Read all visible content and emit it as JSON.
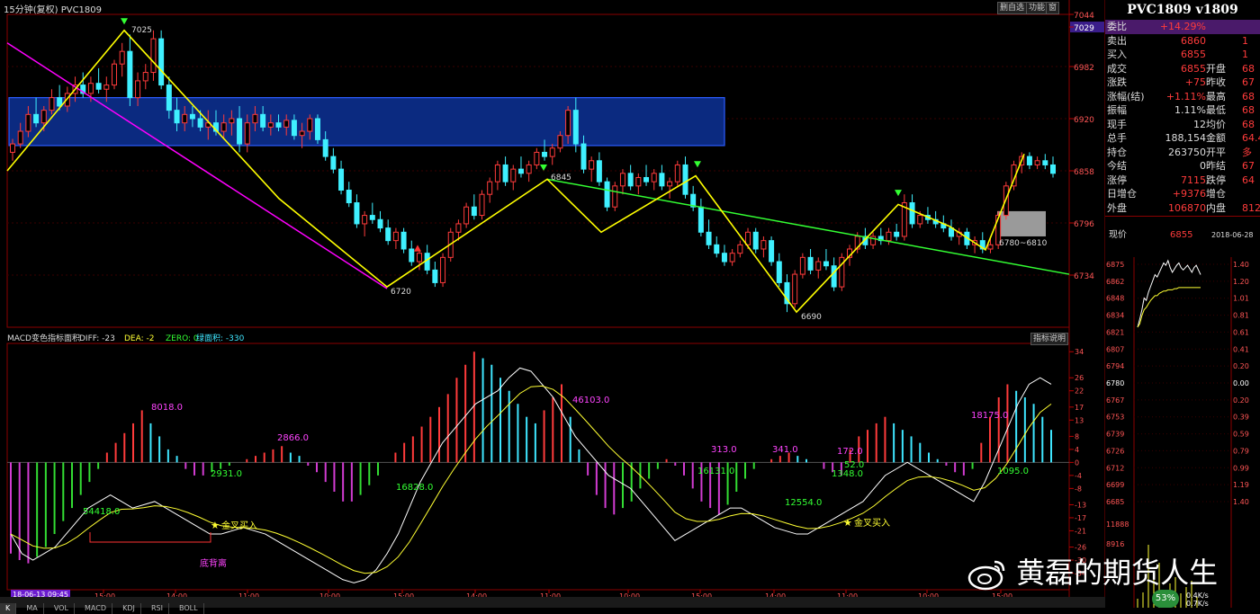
{
  "window": {
    "title": "15分钟(复权)  PVC1809",
    "buttons": [
      "删自选",
      "功能",
      "窗"
    ]
  },
  "price_axis": {
    "ticks": [
      "7044",
      "7029",
      "6982",
      "6920",
      "6858",
      "6796",
      "6734"
    ],
    "current_price_label": "7029"
  },
  "chart_data": [
    {
      "type": "candlestick",
      "title": "15分钟(复权)  PVC1809",
      "ylim": [
        6672,
        7044
      ],
      "x_labels": [
        "18-06-13 09:45",
        "15:00",
        "14:00",
        "11:00",
        "10:00",
        "15:00",
        "14:00",
        "11:00",
        "10:00",
        "15:00",
        "14:00",
        "11:00",
        "10:00",
        "15:00"
      ],
      "annotations": [
        "7025",
        "6720",
        "6845",
        "6690",
        "6780~6810"
      ],
      "ohlc": [
        [
          6880,
          6896,
          6870,
          6890
        ],
        [
          6890,
          6915,
          6885,
          6905
        ],
        [
          6905,
          6935,
          6898,
          6925
        ],
        [
          6925,
          6945,
          6910,
          6915
        ],
        [
          6915,
          6935,
          6905,
          6930
        ],
        [
          6930,
          6955,
          6925,
          6945
        ],
        [
          6945,
          6960,
          6930,
          6935
        ],
        [
          6935,
          6958,
          6928,
          6950
        ],
        [
          6950,
          6970,
          6940,
          6960
        ],
        [
          6960,
          6975,
          6945,
          6950
        ],
        [
          6950,
          6970,
          6940,
          6962
        ],
        [
          6962,
          6980,
          6950,
          6955
        ],
        [
          6955,
          6970,
          6940,
          6960
        ],
        [
          6960,
          6990,
          6955,
          6985
        ],
        [
          6985,
          7010,
          6970,
          7000
        ],
        [
          7000,
          7020,
          6935,
          6945
        ],
        [
          6945,
          6975,
          6935,
          6965
        ],
        [
          6965,
          6985,
          6955,
          6975
        ],
        [
          6975,
          7025,
          6965,
          7015
        ],
        [
          7015,
          7025,
          6955,
          6960
        ],
        [
          6960,
          6970,
          6920,
          6930
        ],
        [
          6930,
          6945,
          6905,
          6915
        ],
        [
          6915,
          6935,
          6905,
          6925
        ],
        [
          6925,
          6935,
          6910,
          6920
        ],
        [
          6920,
          6930,
          6905,
          6910
        ],
        [
          6910,
          6930,
          6895,
          6915
        ],
        [
          6915,
          6930,
          6900,
          6905
        ],
        [
          6905,
          6925,
          6895,
          6915
        ],
        [
          6915,
          6930,
          6900,
          6920
        ],
        [
          6920,
          6935,
          6880,
          6890
        ],
        [
          6890,
          6925,
          6880,
          6915
        ],
        [
          6915,
          6935,
          6905,
          6925
        ],
        [
          6925,
          6935,
          6905,
          6910
        ],
        [
          6910,
          6925,
          6900,
          6915
        ],
        [
          6915,
          6925,
          6905,
          6910
        ],
        [
          6910,
          6925,
          6900,
          6918
        ],
        [
          6918,
          6925,
          6895,
          6900
        ],
        [
          6900,
          6915,
          6885,
          6905
        ],
        [
          6905,
          6925,
          6895,
          6920
        ],
        [
          6920,
          6925,
          6890,
          6895
        ],
        [
          6895,
          6905,
          6870,
          6875
        ],
        [
          6875,
          6885,
          6855,
          6860
        ],
        [
          6860,
          6870,
          6830,
          6835
        ],
        [
          6835,
          6845,
          6815,
          6820
        ],
        [
          6820,
          6830,
          6790,
          6795
        ],
        [
          6795,
          6810,
          6780,
          6805
        ],
        [
          6805,
          6820,
          6795,
          6800
        ],
        [
          6800,
          6810,
          6785,
          6790
        ],
        [
          6790,
          6800,
          6770,
          6775
        ],
        [
          6775,
          6790,
          6765,
          6785
        ],
        [
          6785,
          6790,
          6760,
          6765
        ],
        [
          6765,
          6775,
          6745,
          6750
        ],
        [
          6750,
          6765,
          6740,
          6760
        ],
        [
          6760,
          6770,
          6735,
          6740
        ],
        [
          6740,
          6750,
          6720,
          6725
        ],
        [
          6725,
          6760,
          6720,
          6755
        ],
        [
          6755,
          6790,
          6750,
          6785
        ],
        [
          6785,
          6800,
          6775,
          6795
        ],
        [
          6795,
          6820,
          6790,
          6815
        ],
        [
          6815,
          6830,
          6800,
          6805
        ],
        [
          6805,
          6835,
          6800,
          6830
        ],
        [
          6830,
          6850,
          6820,
          6845
        ],
        [
          6845,
          6870,
          6835,
          6865
        ],
        [
          6865,
          6875,
          6840,
          6845
        ],
        [
          6845,
          6865,
          6835,
          6860
        ],
        [
          6860,
          6875,
          6850,
          6855
        ],
        [
          6855,
          6870,
          6845,
          6865
        ],
        [
          6865,
          6885,
          6860,
          6880
        ],
        [
          6880,
          6895,
          6870,
          6875
        ],
        [
          6875,
          6890,
          6865,
          6885
        ],
        [
          6885,
          6905,
          6880,
          6900
        ],
        [
          6900,
          6935,
          6890,
          6930
        ],
        [
          6930,
          6945,
          6880,
          6890
        ],
        [
          6890,
          6900,
          6855,
          6860
        ],
        [
          6860,
          6875,
          6845,
          6870
        ],
        [
          6870,
          6880,
          6840,
          6845
        ],
        [
          6845,
          6850,
          6810,
          6815
        ],
        [
          6815,
          6845,
          6810,
          6840
        ],
        [
          6840,
          6860,
          6830,
          6855
        ],
        [
          6855,
          6865,
          6835,
          6840
        ],
        [
          6840,
          6855,
          6830,
          6850
        ],
        [
          6850,
          6865,
          6840,
          6845
        ],
        [
          6845,
          6860,
          6835,
          6855
        ],
        [
          6855,
          6865,
          6835,
          6840
        ],
        [
          6840,
          6850,
          6825,
          6845
        ],
        [
          6845,
          6870,
          6840,
          6865
        ],
        [
          6865,
          6875,
          6825,
          6830
        ],
        [
          6830,
          6840,
          6810,
          6815
        ],
        [
          6815,
          6825,
          6780,
          6785
        ],
        [
          6785,
          6800,
          6765,
          6770
        ],
        [
          6770,
          6780,
          6755,
          6760
        ],
        [
          6760,
          6770,
          6745,
          6750
        ],
        [
          6750,
          6765,
          6745,
          6760
        ],
        [
          6760,
          6775,
          6755,
          6770
        ],
        [
          6770,
          6790,
          6765,
          6785
        ],
        [
          6785,
          6790,
          6760,
          6765
        ],
        [
          6765,
          6780,
          6755,
          6775
        ],
        [
          6775,
          6780,
          6745,
          6750
        ],
        [
          6750,
          6760,
          6720,
          6725
        ],
        [
          6725,
          6735,
          6690,
          6700
        ],
        [
          6700,
          6740,
          6695,
          6735
        ],
        [
          6735,
          6760,
          6730,
          6755
        ],
        [
          6755,
          6765,
          6735,
          6740
        ],
        [
          6740,
          6755,
          6730,
          6750
        ],
        [
          6750,
          6765,
          6740,
          6745
        ],
        [
          6745,
          6755,
          6715,
          6720
        ],
        [
          6720,
          6760,
          6715,
          6755
        ],
        [
          6755,
          6770,
          6745,
          6765
        ],
        [
          6765,
          6785,
          6760,
          6780
        ],
        [
          6780,
          6790,
          6765,
          6770
        ],
        [
          6770,
          6785,
          6765,
          6780
        ],
        [
          6780,
          6790,
          6770,
          6775
        ],
        [
          6775,
          6790,
          6770,
          6785
        ],
        [
          6785,
          6795,
          6775,
          6780
        ],
        [
          6780,
          6830,
          6775,
          6820
        ],
        [
          6820,
          6830,
          6790,
          6795
        ],
        [
          6795,
          6810,
          6790,
          6805
        ],
        [
          6805,
          6815,
          6795,
          6800
        ],
        [
          6800,
          6810,
          6790,
          6795
        ],
        [
          6795,
          6805,
          6785,
          6790
        ],
        [
          6790,
          6800,
          6775,
          6780
        ],
        [
          6780,
          6790,
          6770,
          6785
        ],
        [
          6785,
          6790,
          6765,
          6770
        ],
        [
          6770,
          6780,
          6760,
          6775
        ],
        [
          6775,
          6785,
          6760,
          6765
        ],
        [
          6765,
          6780,
          6760,
          6770
        ],
        [
          6770,
          6810,
          6765,
          6805
        ],
        [
          6805,
          6845,
          6800,
          6840
        ],
        [
          6840,
          6870,
          6835,
          6865
        ],
        [
          6865,
          6880,
          6855,
          6875
        ],
        [
          6875,
          6880,
          6860,
          6865
        ],
        [
          6865,
          6875,
          6860,
          6870
        ],
        [
          6870,
          6878,
          6860,
          6865
        ],
        [
          6865,
          6875,
          6850,
          6855
        ]
      ]
    },
    {
      "type": "bar",
      "title": "MACD变色指标面积",
      "legend": [
        "DIFF: -23",
        "DEA: -2",
        "ZERO: 0",
        "绿面积: -330"
      ],
      "ylim": [
        -38,
        36
      ],
      "y_ticks": [
        "34",
        "26",
        "22",
        "17",
        "13",
        "8",
        "4",
        "0",
        "-4",
        "-8",
        "-13",
        "-17",
        "-21",
        "-26",
        "-30",
        "-34"
      ],
      "annotations": [
        "8018.0",
        "54418.0",
        "2931.0",
        "2866.0",
        "16828.0",
        "46103.0",
        "313.0",
        "16131.0",
        "341.0",
        "172.0",
        "52.0",
        "1348.0",
        "12554.0",
        "18175.0",
        "1095.0",
        "底背离",
        "金叉买入",
        "金叉买入"
      ],
      "values": [
        -28,
        -30,
        -31,
        -29,
        -26,
        -22,
        -18,
        -14,
        -10,
        -6,
        -2,
        3,
        6,
        9,
        12,
        16,
        12,
        8,
        4,
        2,
        -2,
        -4,
        -4,
        -3,
        -2,
        -1,
        0,
        1,
        2,
        3,
        4,
        5,
        3,
        2,
        -1,
        -3,
        -6,
        -9,
        -12,
        -12,
        -10,
        -7,
        -4,
        0,
        3,
        6,
        8,
        11,
        14,
        17,
        21,
        26,
        30,
        34,
        32,
        30,
        26,
        22,
        18,
        14,
        12,
        16,
        20,
        24,
        14,
        4,
        -4,
        -10,
        -14,
        -16,
        -14,
        -12,
        -8,
        -5,
        -2,
        1,
        -1,
        -4,
        -8,
        -12,
        -14,
        -16,
        -13,
        -9,
        -5,
        -2,
        0,
        1,
        2,
        3,
        2,
        1,
        0,
        -2,
        -3,
        -4,
        4,
        8,
        10,
        12,
        14,
        12,
        10,
        8,
        6,
        3,
        1,
        -1,
        -3,
        -4,
        -2,
        6,
        14,
        20,
        24,
        22,
        20,
        18,
        14,
        10
      ],
      "diff": [
        -22,
        -28,
        -30,
        -28,
        -26,
        -22,
        -18,
        -14,
        -12,
        -10,
        -12,
        -14,
        -13,
        -12,
        -14,
        -16,
        -18,
        -20,
        -22,
        -22,
        -21,
        -20,
        -21,
        -22,
        -24,
        -26,
        -28,
        -30,
        -32,
        -34,
        -36,
        -37,
        -36,
        -33,
        -28,
        -22,
        -14,
        -6,
        0,
        6,
        10,
        14,
        18,
        20,
        22,
        26,
        29,
        28,
        24,
        20,
        14,
        8,
        4,
        0,
        -4,
        -6,
        -8,
        -12,
        -16,
        -20,
        -24,
        -22,
        -20,
        -18,
        -16,
        -14,
        -14,
        -16,
        -18,
        -20,
        -21,
        -22,
        -22,
        -20,
        -18,
        -16,
        -14,
        -12,
        -8,
        -4,
        -2,
        0,
        -2,
        -4,
        -6,
        -8,
        -10,
        -12,
        -6,
        2,
        10,
        18,
        24,
        26,
        24
      ]
    },
    {
      "type": "line",
      "title": "分时",
      "date": "2018-06-28",
      "ylim": [
        6672,
        6875
      ],
      "y_ticks": [
        "6875",
        "6862",
        "6848",
        "6834",
        "6821",
        "6807",
        "6794",
        "6780",
        "6767",
        "6753",
        "6739",
        "6726",
        "6712",
        "6699",
        "6685"
      ],
      "pct_ticks": [
        "1.40",
        "1.20",
        "1.01",
        "0.81",
        "0.61",
        "0.41",
        "0.20",
        "0.00",
        "0.20",
        "0.39",
        "0.59",
        "0.79",
        "0.99",
        "1.19",
        "1.40"
      ],
      "volume_ticks": [
        "11888",
        "8916"
      ],
      "price": [
        6815,
        6822,
        6830,
        6840,
        6838,
        6845,
        6850,
        6855,
        6860,
        6858,
        6862,
        6866,
        6870,
        6868,
        6872,
        6866,
        6862,
        6865,
        6868,
        6870,
        6866,
        6864,
        6866,
        6868,
        6865,
        6862,
        6866,
        6868,
        6864,
        6860
      ],
      "avg": [
        6815,
        6818,
        6825,
        6830,
        6832,
        6835,
        6838,
        6840,
        6842,
        6842,
        6844,
        6845,
        6846,
        6846,
        6847,
        6847,
        6847,
        6848,
        6848,
        6849,
        6849,
        6849,
        6849,
        6849,
        6849,
        6849,
        6849,
        6849,
        6849,
        6849
      ]
    }
  ],
  "quote_panel": {
    "title": "PVC1809 v1809",
    "rows": [
      {
        "k": "委比",
        "v": "+14.29%",
        "vc": "red",
        "k2": "",
        "v2": ""
      },
      {
        "k": "卖出",
        "v": "6860",
        "vc": "red",
        "k2": "",
        "v2": "1"
      },
      {
        "k": "买入",
        "v": "6855",
        "vc": "red",
        "k2": "",
        "v2": "1"
      },
      {
        "k": "成交",
        "v": "6855",
        "vc": "red",
        "k2": "开盘",
        "v2": "68"
      },
      {
        "k": "涨跌",
        "v": "+75",
        "vc": "red",
        "k2": "昨收",
        "v2": "67"
      },
      {
        "k": "涨幅(结)",
        "v": "+1.11%",
        "vc": "red",
        "k2": "最高",
        "v2": "68"
      },
      {
        "k": "振幅",
        "v": "1.11%",
        "vc": "white",
        "k2": "最低",
        "v2": "68"
      },
      {
        "k": "现手",
        "v": "12",
        "vc": "white",
        "k2": "均价",
        "v2": "68"
      },
      {
        "k": "总手",
        "v": "188,154",
        "vc": "white",
        "k2": "金额",
        "v2": "64.43"
      },
      {
        "k": "持仓",
        "v": "263750",
        "vc": "white",
        "k2": "开平",
        "v2": "多"
      },
      {
        "k": "今结",
        "v": "0",
        "vc": "white",
        "k2": "昨结",
        "v2": "67"
      },
      {
        "k": "涨停",
        "v": "7115",
        "vc": "red",
        "k2": "跌停",
        "v2": "64"
      },
      {
        "k": "日增仓",
        "v": "+9376",
        "vc": "red",
        "k2": "增仓",
        "v2": ""
      },
      {
        "k": "外盘",
        "v": "106870",
        "vc": "red",
        "k2": "内盘",
        "v2": "812"
      }
    ],
    "intraday_label": "现价",
    "intraday_value": "6855",
    "intraday_date": "2018-06-28"
  },
  "help_button": "指标说明",
  "footer": {
    "weibo_text": "黄磊的期货人生",
    "percent_badge": "53%",
    "net_up": "0.4K/s",
    "net_down": "0.7K/s"
  },
  "colors": {
    "up": "#ff3b3b",
    "down": "#3ff0ff",
    "wave": "#ffff00",
    "channel": "#ff00ff",
    "trendline": "#33ff33",
    "zone": "#0b2a80",
    "macd_pos_red": "#ff3b3b",
    "macd_pos_cyan": "#3fe6ff",
    "macd_neg_magenta": "#d23cd2",
    "macd_neg_green": "#33dd33"
  }
}
